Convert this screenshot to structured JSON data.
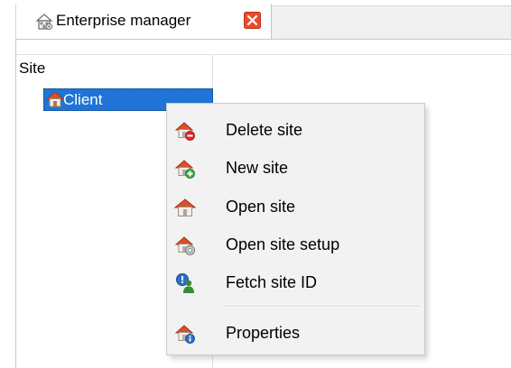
{
  "tab": {
    "title": "Enterprise manager",
    "icon": "enterprise-icon",
    "close_icon": "close-icon"
  },
  "tree": {
    "root_label": "Site",
    "node_label": "Client",
    "node_icon": "house-icon",
    "selection_color": "#1f74d6"
  },
  "context_menu": {
    "items": [
      {
        "label": "Delete site",
        "icon": "house-delete-icon"
      },
      {
        "label": "New site",
        "icon": "house-add-icon"
      },
      {
        "label": "Open site",
        "icon": "house-open-icon"
      },
      {
        "label": "Open site setup",
        "icon": "house-setup-icon"
      },
      {
        "label": "Fetch site ID",
        "icon": "fetch-id-icon"
      },
      {
        "label": "Properties",
        "icon": "house-info-icon"
      }
    ]
  },
  "colors": {
    "house_roof": "#d9502b",
    "house_wall": "#e8e4da",
    "close_red": "#e84c2e"
  }
}
